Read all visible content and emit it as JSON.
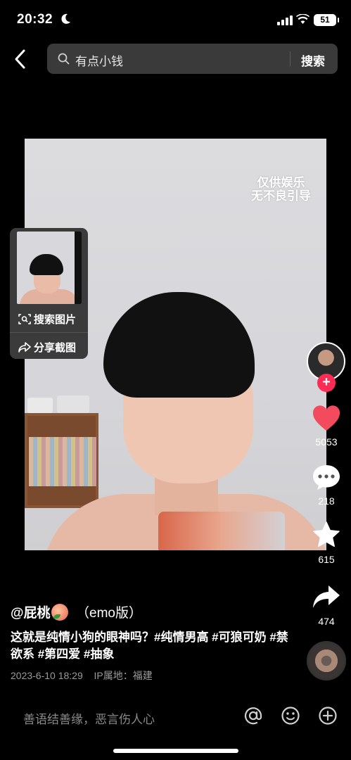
{
  "status_bar": {
    "time": "20:32",
    "battery": "51",
    "icons": [
      "moon-icon",
      "signal-icon",
      "wifi-icon",
      "battery-icon"
    ]
  },
  "search": {
    "query": "有点小钱",
    "submit_label": "搜索"
  },
  "video": {
    "watermark_line1": "仅供娱乐",
    "watermark_line2": "无不良引导"
  },
  "screenshot_card": {
    "search_image_label": "搜索图片",
    "share_screenshot_label": "分享截图"
  },
  "rail": {
    "like_count": "5053",
    "comment_count": "218",
    "favorite_count": "615",
    "share_count": "474",
    "accent_color": "#fe2c55"
  },
  "post": {
    "author": "@屁桃",
    "author_suffix": "（emo版）",
    "caption": "这就是纯情小狗的眼神吗？#纯情男高 #可狼可奶 #禁欲系 #第四爱 #抽象",
    "date": "2023-6-10 18:29",
    "location": "IP属地：福建"
  },
  "comment_bar": {
    "placeholder": "善语结善缘，恶言伤人心"
  }
}
